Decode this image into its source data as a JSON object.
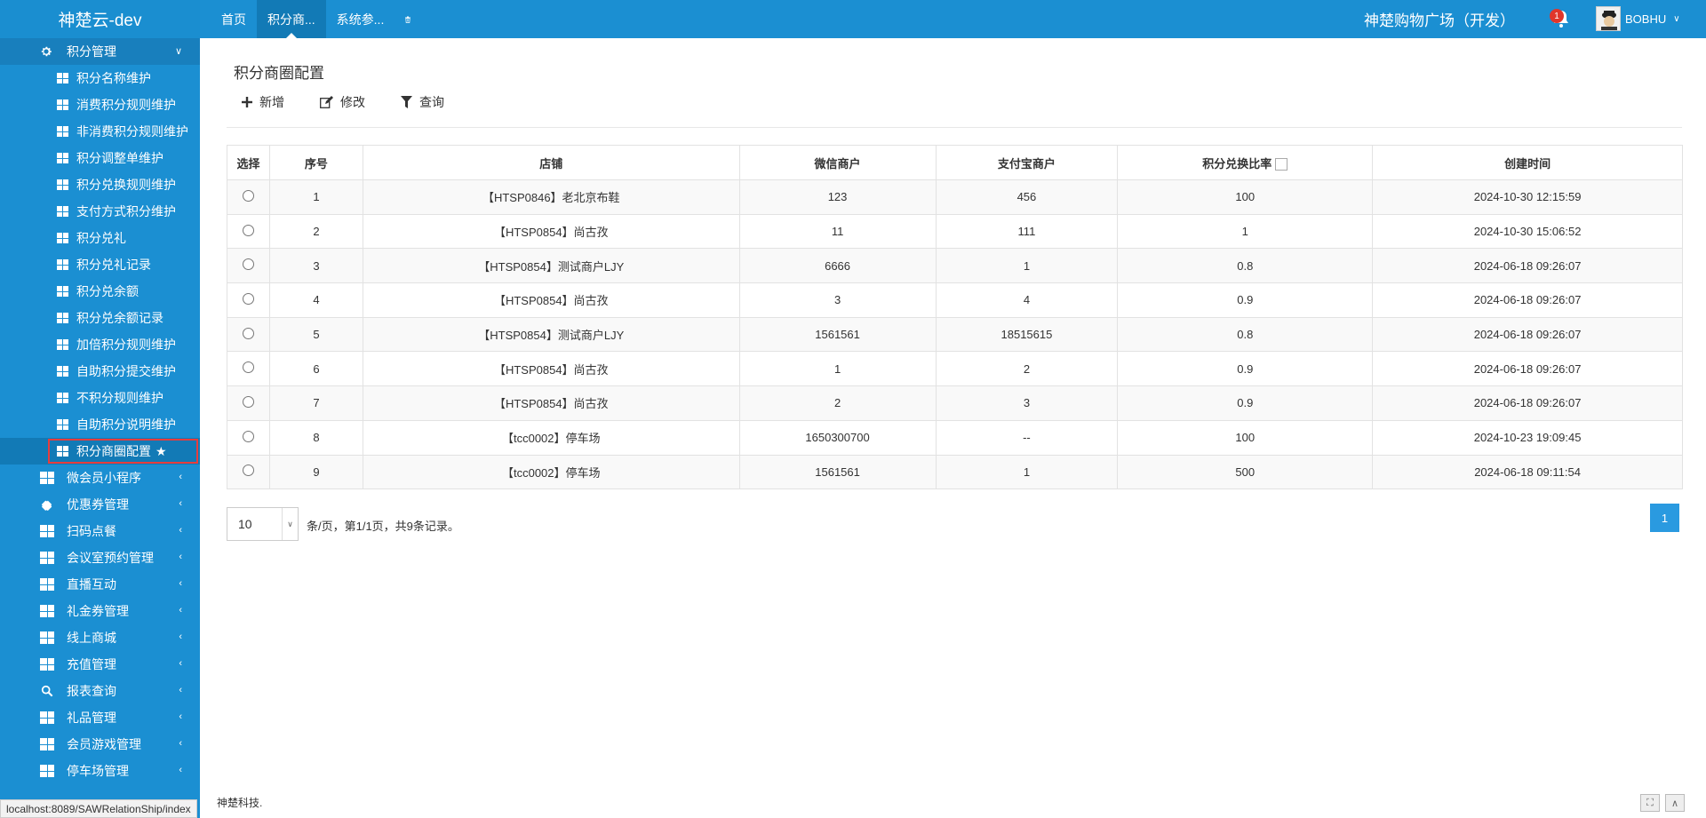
{
  "brand": "神楚云-dev",
  "topnav": {
    "tabs": [
      {
        "label": "首页"
      },
      {
        "label": "积分商..."
      },
      {
        "label": "系统参..."
      }
    ]
  },
  "header": {
    "mall_name": "神楚购物广场（开发）",
    "notification_count": "1",
    "username": "BOBHU"
  },
  "sidebar": {
    "open_group": "积分管理",
    "sub_items": [
      {
        "label": "积分名称维护"
      },
      {
        "label": "消费积分规则维护"
      },
      {
        "label": "非消费积分规则维护"
      },
      {
        "label": "积分调整单维护"
      },
      {
        "label": "积分兑换规则维护"
      },
      {
        "label": "支付方式积分维护"
      },
      {
        "label": "积分兑礼"
      },
      {
        "label": "积分兑礼记录"
      },
      {
        "label": "积分兑余额"
      },
      {
        "label": "积分兑余额记录"
      },
      {
        "label": "加倍积分规则维护"
      },
      {
        "label": "自助积分提交维护"
      },
      {
        "label": "不积分规则维护"
      },
      {
        "label": "自助积分说明维护"
      },
      {
        "label": "积分商圈配置"
      }
    ],
    "groups": [
      {
        "label": "微会员小程序",
        "icon": "windows-icon"
      },
      {
        "label": "优惠券管理",
        "icon": "ticket-icon"
      },
      {
        "label": "扫码点餐",
        "icon": "windows-icon"
      },
      {
        "label": "会议室预约管理",
        "icon": "windows-icon"
      },
      {
        "label": "直播互动",
        "icon": "windows-icon"
      },
      {
        "label": "礼金券管理",
        "icon": "windows-icon"
      },
      {
        "label": "线上商城",
        "icon": "windows-icon"
      },
      {
        "label": "充值管理",
        "icon": "windows-icon"
      },
      {
        "label": "报表查询",
        "icon": "search-icon"
      },
      {
        "label": "礼品管理",
        "icon": "windows-icon"
      },
      {
        "label": "会员游戏管理",
        "icon": "windows-icon"
      },
      {
        "label": "停车场管理",
        "icon": "windows-icon"
      }
    ]
  },
  "main": {
    "title": "积分商圈配置",
    "toolbar": {
      "add": "新增",
      "edit": "修改",
      "query": "查询"
    },
    "table": {
      "headers": [
        "选择",
        "序号",
        "店铺",
        "微信商户",
        "支付宝商户",
        "积分兑换比率",
        "创建时间"
      ],
      "rows": [
        [
          "1",
          "【HTSP0846】老北京布鞋",
          "123",
          "456",
          "100",
          "2024-10-30 12:15:59"
        ],
        [
          "2",
          "【HTSP0854】尚古孜",
          "11",
          "111",
          "1",
          "2024-10-30 15:06:52"
        ],
        [
          "3",
          "【HTSP0854】测试商户LJY",
          "6666",
          "1",
          "0.8",
          "2024-06-18 09:26:07"
        ],
        [
          "4",
          "【HTSP0854】尚古孜",
          "3",
          "4",
          "0.9",
          "2024-06-18 09:26:07"
        ],
        [
          "5",
          "【HTSP0854】测试商户LJY",
          "1561561",
          "18515615",
          "0.8",
          "2024-06-18 09:26:07"
        ],
        [
          "6",
          "【HTSP0854】尚古孜",
          "1",
          "2",
          "0.9",
          "2024-06-18 09:26:07"
        ],
        [
          "7",
          "【HTSP0854】尚古孜",
          "2",
          "3",
          "0.9",
          "2024-06-18 09:26:07"
        ],
        [
          "8",
          "【tcc0002】停车场",
          "1650300700",
          "--",
          "100",
          "2024-10-23 19:09:45"
        ],
        [
          "9",
          "【tcc0002】停车场",
          "1561561",
          "1",
          "500",
          "2024-06-18 09:11:54"
        ]
      ]
    },
    "pager": {
      "page_size": "10",
      "info": "条/页，第1/1页，共9条记录。",
      "current_page": "1"
    }
  },
  "footer": {
    "company": "神楚科技."
  },
  "statusbar": {
    "url": "localhost:8089/SAWRelationShip/index"
  }
}
